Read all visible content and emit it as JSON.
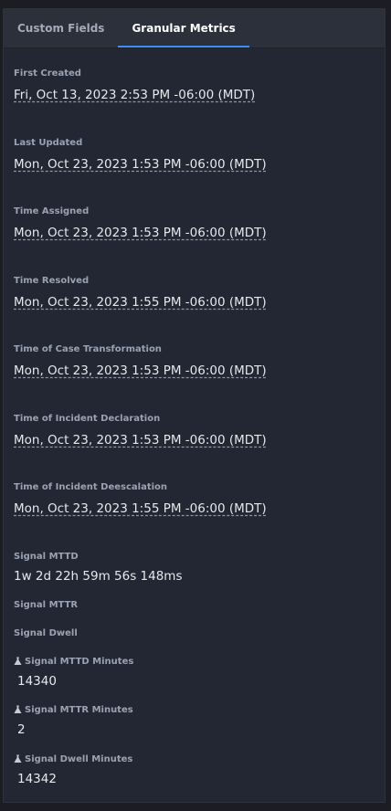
{
  "tabs": [
    {
      "label": "Custom Fields",
      "active": false
    },
    {
      "label": "Granular Metrics",
      "active": true
    }
  ],
  "date_fields": [
    {
      "label": "First Created",
      "value": "Fri, Oct 13, 2023 2:53 PM -06:00 (MDT)"
    },
    {
      "label": "Last Updated",
      "value": "Mon, Oct 23, 2023 1:53 PM -06:00 (MDT)"
    },
    {
      "label": "Time Assigned",
      "value": "Mon, Oct 23, 2023 1:53 PM -06:00 (MDT)"
    },
    {
      "label": "Time Resolved",
      "value": "Mon, Oct 23, 2023 1:55 PM -06:00 (MDT)"
    },
    {
      "label": "Time of Case Transformation",
      "value": "Mon, Oct 23, 2023 1:53 PM -06:00 (MDT)"
    },
    {
      "label": "Time of Incident Declaration",
      "value": "Mon, Oct 23, 2023 1:53 PM -06:00 (MDT)"
    },
    {
      "label": "Time of Incident Deescalation",
      "value": "Mon, Oct 23, 2023 1:55 PM -06:00 (MDT)"
    }
  ],
  "signal": {
    "mttd_label": "Signal MTTD",
    "mttd_value": "1w 2d 22h 59m 56s 148ms",
    "mttr_label": "Signal MTTR",
    "dwell_label": "Signal Dwell"
  },
  "minutes_fields": [
    {
      "label": "Signal MTTD Minutes",
      "value": "14340",
      "icon": "flask-icon"
    },
    {
      "label": "Signal MTTR Minutes",
      "value": "2",
      "icon": "flask-icon"
    },
    {
      "label": "Signal Dwell Minutes",
      "value": "14342",
      "icon": "flask-icon"
    }
  ],
  "colors": {
    "background": "#232733",
    "tab_bar": "#2b303b",
    "active_tab_indicator": "#3e8ef7",
    "label": "#9aa3b3",
    "value": "#e6e8ec"
  }
}
